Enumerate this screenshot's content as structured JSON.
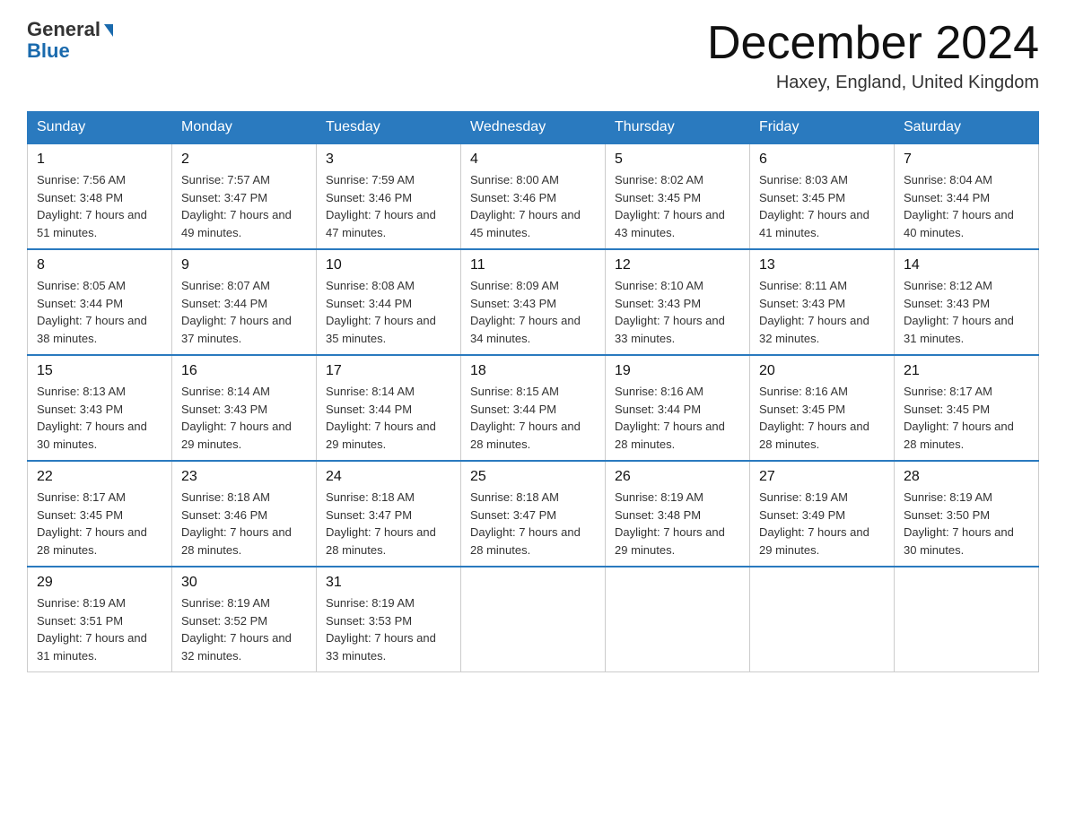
{
  "header": {
    "logo_general": "General",
    "logo_blue": "Blue",
    "month_title": "December 2024",
    "location": "Haxey, England, United Kingdom"
  },
  "days_of_week": [
    "Sunday",
    "Monday",
    "Tuesday",
    "Wednesday",
    "Thursday",
    "Friday",
    "Saturday"
  ],
  "weeks": [
    [
      {
        "num": "1",
        "sunrise": "7:56 AM",
        "sunset": "3:48 PM",
        "daylight": "7 hours and 51 minutes."
      },
      {
        "num": "2",
        "sunrise": "7:57 AM",
        "sunset": "3:47 PM",
        "daylight": "7 hours and 49 minutes."
      },
      {
        "num": "3",
        "sunrise": "7:59 AM",
        "sunset": "3:46 PM",
        "daylight": "7 hours and 47 minutes."
      },
      {
        "num": "4",
        "sunrise": "8:00 AM",
        "sunset": "3:46 PM",
        "daylight": "7 hours and 45 minutes."
      },
      {
        "num": "5",
        "sunrise": "8:02 AM",
        "sunset": "3:45 PM",
        "daylight": "7 hours and 43 minutes."
      },
      {
        "num": "6",
        "sunrise": "8:03 AM",
        "sunset": "3:45 PM",
        "daylight": "7 hours and 41 minutes."
      },
      {
        "num": "7",
        "sunrise": "8:04 AM",
        "sunset": "3:44 PM",
        "daylight": "7 hours and 40 minutes."
      }
    ],
    [
      {
        "num": "8",
        "sunrise": "8:05 AM",
        "sunset": "3:44 PM",
        "daylight": "7 hours and 38 minutes."
      },
      {
        "num": "9",
        "sunrise": "8:07 AM",
        "sunset": "3:44 PM",
        "daylight": "7 hours and 37 minutes."
      },
      {
        "num": "10",
        "sunrise": "8:08 AM",
        "sunset": "3:44 PM",
        "daylight": "7 hours and 35 minutes."
      },
      {
        "num": "11",
        "sunrise": "8:09 AM",
        "sunset": "3:43 PM",
        "daylight": "7 hours and 34 minutes."
      },
      {
        "num": "12",
        "sunrise": "8:10 AM",
        "sunset": "3:43 PM",
        "daylight": "7 hours and 33 minutes."
      },
      {
        "num": "13",
        "sunrise": "8:11 AM",
        "sunset": "3:43 PM",
        "daylight": "7 hours and 32 minutes."
      },
      {
        "num": "14",
        "sunrise": "8:12 AM",
        "sunset": "3:43 PM",
        "daylight": "7 hours and 31 minutes."
      }
    ],
    [
      {
        "num": "15",
        "sunrise": "8:13 AM",
        "sunset": "3:43 PM",
        "daylight": "7 hours and 30 minutes."
      },
      {
        "num": "16",
        "sunrise": "8:14 AM",
        "sunset": "3:43 PM",
        "daylight": "7 hours and 29 minutes."
      },
      {
        "num": "17",
        "sunrise": "8:14 AM",
        "sunset": "3:44 PM",
        "daylight": "7 hours and 29 minutes."
      },
      {
        "num": "18",
        "sunrise": "8:15 AM",
        "sunset": "3:44 PM",
        "daylight": "7 hours and 28 minutes."
      },
      {
        "num": "19",
        "sunrise": "8:16 AM",
        "sunset": "3:44 PM",
        "daylight": "7 hours and 28 minutes."
      },
      {
        "num": "20",
        "sunrise": "8:16 AM",
        "sunset": "3:45 PM",
        "daylight": "7 hours and 28 minutes."
      },
      {
        "num": "21",
        "sunrise": "8:17 AM",
        "sunset": "3:45 PM",
        "daylight": "7 hours and 28 minutes."
      }
    ],
    [
      {
        "num": "22",
        "sunrise": "8:17 AM",
        "sunset": "3:45 PM",
        "daylight": "7 hours and 28 minutes."
      },
      {
        "num": "23",
        "sunrise": "8:18 AM",
        "sunset": "3:46 PM",
        "daylight": "7 hours and 28 minutes."
      },
      {
        "num": "24",
        "sunrise": "8:18 AM",
        "sunset": "3:47 PM",
        "daylight": "7 hours and 28 minutes."
      },
      {
        "num": "25",
        "sunrise": "8:18 AM",
        "sunset": "3:47 PM",
        "daylight": "7 hours and 28 minutes."
      },
      {
        "num": "26",
        "sunrise": "8:19 AM",
        "sunset": "3:48 PM",
        "daylight": "7 hours and 29 minutes."
      },
      {
        "num": "27",
        "sunrise": "8:19 AM",
        "sunset": "3:49 PM",
        "daylight": "7 hours and 29 minutes."
      },
      {
        "num": "28",
        "sunrise": "8:19 AM",
        "sunset": "3:50 PM",
        "daylight": "7 hours and 30 minutes."
      }
    ],
    [
      {
        "num": "29",
        "sunrise": "8:19 AM",
        "sunset": "3:51 PM",
        "daylight": "7 hours and 31 minutes."
      },
      {
        "num": "30",
        "sunrise": "8:19 AM",
        "sunset": "3:52 PM",
        "daylight": "7 hours and 32 minutes."
      },
      {
        "num": "31",
        "sunrise": "8:19 AM",
        "sunset": "3:53 PM",
        "daylight": "7 hours and 33 minutes."
      },
      null,
      null,
      null,
      null
    ]
  ]
}
